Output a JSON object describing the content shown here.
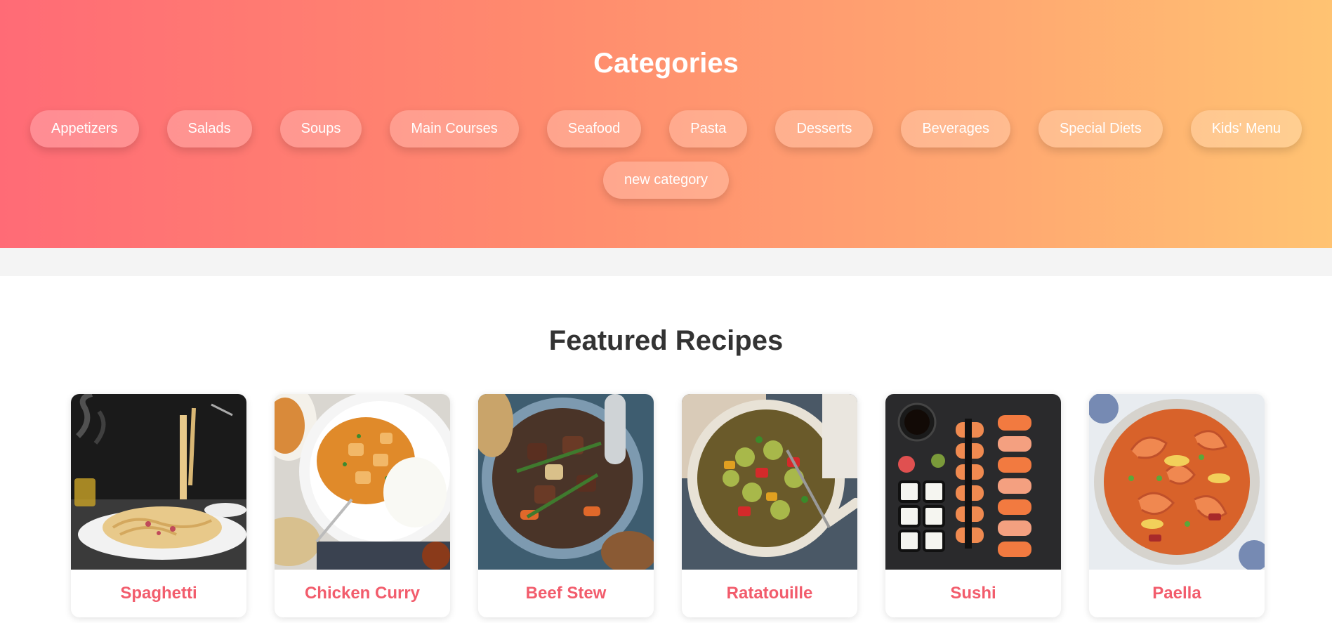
{
  "categories": {
    "title": "Categories",
    "items": [
      {
        "label": "Appetizers"
      },
      {
        "label": "Salads"
      },
      {
        "label": "Soups"
      },
      {
        "label": "Main Courses"
      },
      {
        "label": "Seafood"
      },
      {
        "label": "Pasta"
      },
      {
        "label": "Desserts"
      },
      {
        "label": "Beverages"
      },
      {
        "label": "Special Diets"
      },
      {
        "label": "Kids' Menu"
      }
    ],
    "new_category": "new category"
  },
  "featured": {
    "title": "Featured Recipes",
    "recipes": [
      {
        "name": "Spaghetti"
      },
      {
        "name": "Chicken Curry"
      },
      {
        "name": "Beef Stew"
      },
      {
        "name": "Ratatouille"
      },
      {
        "name": "Sushi"
      },
      {
        "name": "Paella"
      }
    ]
  },
  "colors": {
    "gradient_start": "#ff6b76",
    "gradient_end": "#ffc372",
    "recipe_name": "#f25c6c",
    "heading_dark": "#333333"
  }
}
